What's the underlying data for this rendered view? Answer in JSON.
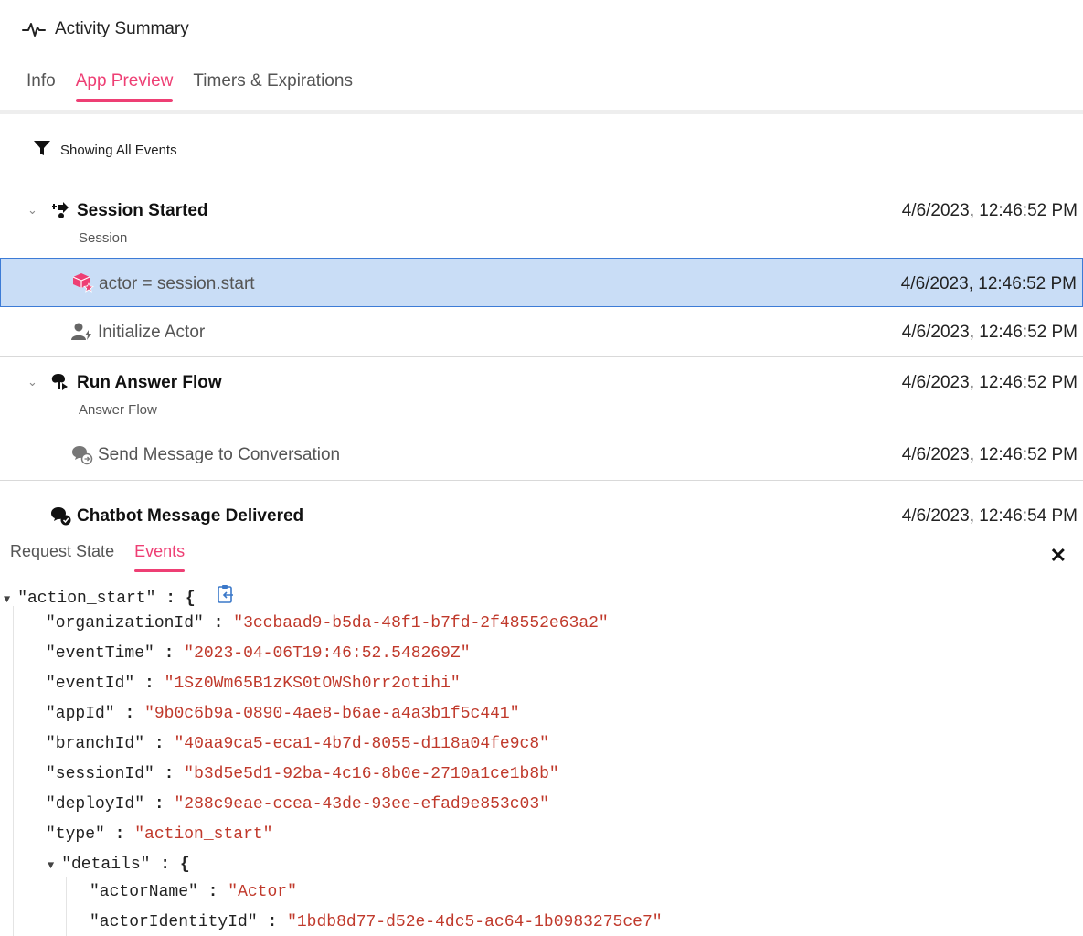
{
  "header": {
    "icon": "activity-pulse-icon",
    "title": "Activity Summary",
    "tabs": [
      {
        "label": "Info",
        "active": false
      },
      {
        "label": "App Preview",
        "active": true
      },
      {
        "label": "Timers & Expirations",
        "active": false
      }
    ]
  },
  "filter": {
    "icon": "filter-icon",
    "label": "Showing All Events"
  },
  "events": [
    {
      "title": "Session Started",
      "subtitle": "Session",
      "time": "4/6/2023, 12:46:52 PM",
      "icon": "session-start-icon"
    },
    {
      "title": "actor = session.start",
      "time": "4/6/2023, 12:46:52 PM",
      "icon": "actor-cube-icon",
      "selected": true
    },
    {
      "title": "Initialize Actor",
      "time": "4/6/2023, 12:46:52 PM",
      "icon": "user-bolt-icon"
    },
    {
      "title": "Run Answer Flow",
      "subtitle": "Answer Flow",
      "time": "4/6/2023, 12:46:52 PM",
      "icon": "flow-icon"
    },
    {
      "title": "Send Message to Conversation",
      "time": "4/6/2023, 12:46:52 PM",
      "icon": "chat-send-icon"
    },
    {
      "title": "Chatbot Message Delivered",
      "time": "4/6/2023, 12:46:54 PM",
      "icon": "chat-delivered-icon"
    }
  ],
  "panel": {
    "tabs": [
      {
        "label": "Request State",
        "active": false
      },
      {
        "label": "Events",
        "active": true
      }
    ],
    "close_icon": "close-icon",
    "json": {
      "root_key": "\"action_start\"",
      "entries": [
        {
          "key": "\"organizationId\"",
          "value": "\"3ccbaad9-b5da-48f1-b7fd-2f48552e63a2\""
        },
        {
          "key": "\"eventTime\"",
          "value": "\"2023-04-06T19:46:52.548269Z\""
        },
        {
          "key": "\"eventId\"",
          "value": "\"1Sz0Wm65B1zKS0tOWSh0rr2otihi\""
        },
        {
          "key": "\"appId\"",
          "value": "\"9b0c6b9a-0890-4ae8-b6ae-a4a3b1f5c441\""
        },
        {
          "key": "\"branchId\"",
          "value": "\"40aa9ca5-eca1-4b7d-8055-d118a04fe9c8\""
        },
        {
          "key": "\"sessionId\"",
          "value": "\"b3d5e5d1-92ba-4c16-8b0e-2710a1ce1b8b\""
        },
        {
          "key": "\"deployId\"",
          "value": "\"288c9eae-ccea-43de-93ee-efad9e853c03\""
        },
        {
          "key": "\"type\"",
          "value": "\"action_start\""
        }
      ],
      "details_key": "\"details\"",
      "details": [
        {
          "key": "\"actorName\"",
          "value": "\"Actor\""
        },
        {
          "key": "\"actorIdentityId\"",
          "value": "\"1bdb8d77-d52e-4dc5-ac64-1b0983275ce7\""
        }
      ],
      "colon": ":",
      "brace": "{"
    }
  }
}
